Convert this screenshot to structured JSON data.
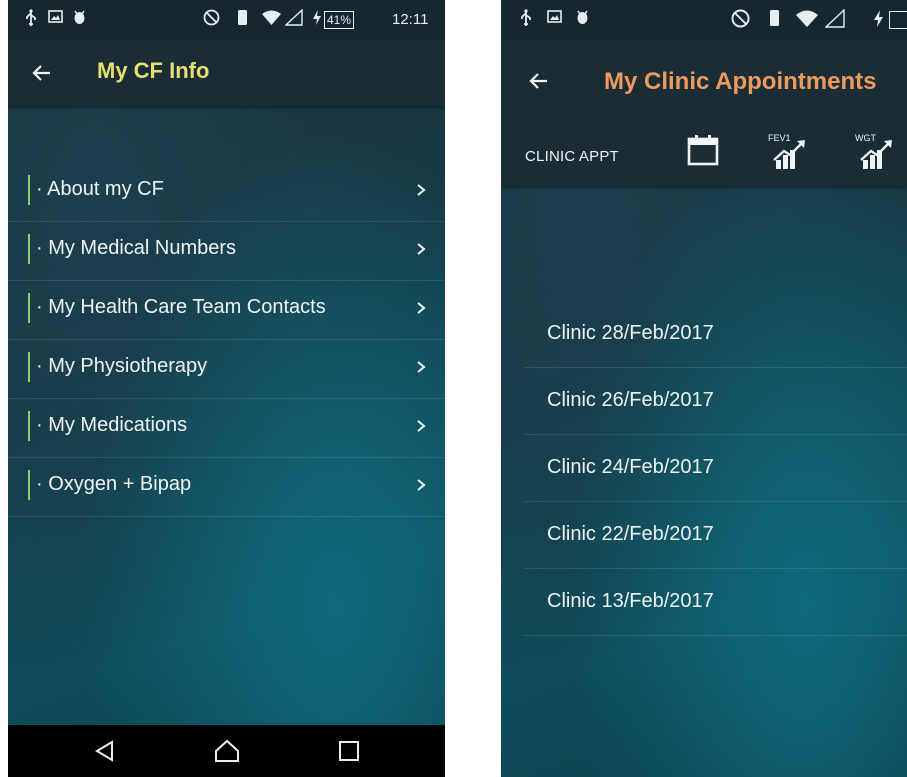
{
  "left_screen": {
    "status_bar": {
      "battery": "41%",
      "time": "12:11"
    },
    "title": "My CF Info",
    "menu_items": [
      {
        "label": "· About my CF"
      },
      {
        "label": "· My Medical Numbers"
      },
      {
        "label": "· My Health Care Team Contacts"
      },
      {
        "label": "· My Physiotherapy"
      },
      {
        "label": "· My Medications"
      },
      {
        "label": "· Oxygen + Bipap"
      }
    ]
  },
  "right_screen": {
    "title": "My Clinic Appointments",
    "toolbar": {
      "clinic_appt_label": "CLINIC APPT",
      "fev1_label": "FEV1",
      "wgt_label": "WGT"
    },
    "appointments": [
      {
        "label": "Clinic 28/Feb/2017"
      },
      {
        "label": "Clinic 26/Feb/2017"
      },
      {
        "label": "Clinic 24/Feb/2017"
      },
      {
        "label": "Clinic 22/Feb/2017"
      },
      {
        "label": "Clinic 13/Feb/2017"
      }
    ]
  },
  "colors": {
    "title_left": "#e8de6f",
    "title_right": "#ee9a5e",
    "menu_accent": "#8fcf6a",
    "app_bar": "#1a2d35"
  },
  "icons": {
    "usb": "usb-icon",
    "image": "image-notification-icon",
    "android": "android-debug-icon",
    "do_not_disturb": "do-not-disturb-icon",
    "vibrate": "vibrate-icon",
    "wifi": "wifi-icon",
    "signal": "signal-icon",
    "charging": "charging-icon",
    "back": "back-arrow-icon",
    "chevron": "chevron-right-icon",
    "calendar": "calendar-icon",
    "chart": "trend-chart-icon",
    "nav_back": "nav-back-icon",
    "nav_home": "nav-home-icon",
    "nav_recents": "nav-recents-icon"
  }
}
